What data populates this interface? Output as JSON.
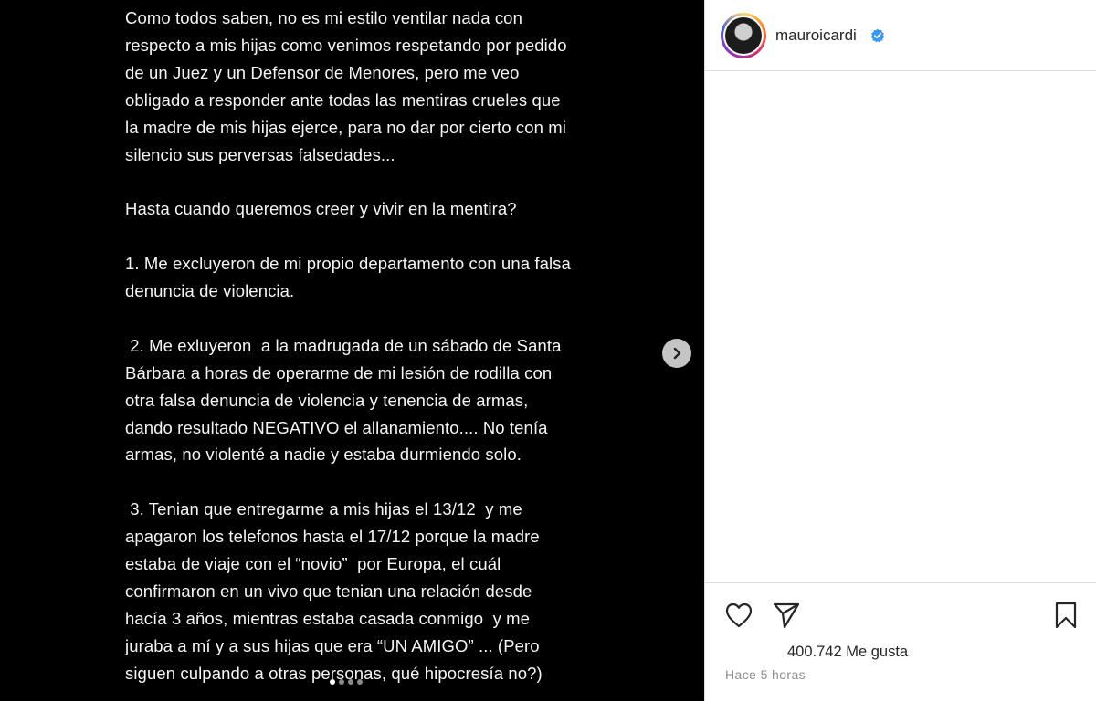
{
  "post": {
    "lines": [
      "Como todos saben, no es mi estilo ventilar nada con",
      "respecto a mis hijas como venimos respetando por pedido",
      "de un Juez y un Defensor de Menores, pero me veo",
      "obligado a responder ante todas las mentiras crueles que",
      "la madre de mis hijas ejerce, para no dar por cierto con mi",
      "silencio sus perversas falsedades...",
      "",
      "Hasta cuando queremos creer y vivir en la mentira?",
      "",
      "1. Me excluyeron de mi propio departamento con una falsa",
      "denuncia de violencia.",
      "",
      " 2. Me exluyeron  a la madrugada de un sábado de Santa",
      "Bárbara a horas de operarme de mi lesión de rodilla con",
      "otra falsa denuncia de violencia y tenencia de armas,",
      "dando resultado NEGATIVO el allanamiento.... No tenía",
      "armas, no violenté a nadie y estaba durmiendo solo.",
      "",
      " 3. Tenian que entregarme a mis hijas el 13/12  y me",
      "apagaron los telefonos hasta el 17/12 porque la madre",
      "estaba de viaje con el “novio”  por Europa, el cuál",
      "confirmaron en un vivo que tenian una relación desde",
      "hacía 3 años, mientras estaba casada conmigo  y me",
      "juraba a mí y a sus hijas que era “UN AMIGO” ... (Pero",
      "siguen culpando a otras personas, qué hipocresía no?)"
    ],
    "carousel": {
      "total": 4,
      "active": 1
    },
    "next_icon": "chevron-right-icon"
  },
  "profile": {
    "username": "mauroicardi",
    "verified_icon": "verified-badge-icon"
  },
  "actions": {
    "like_icon": "heart-icon",
    "share_icon": "paper-plane-icon",
    "save_icon": "bookmark-icon"
  },
  "likes_text": "400.742 Me gusta",
  "timestamp": "Hace 5 horas",
  "colors": {
    "media_bg": "#000000",
    "text_on_media": "#f5f5f5",
    "verified_blue": "#3897f0",
    "muted": "#8e8e8e"
  }
}
